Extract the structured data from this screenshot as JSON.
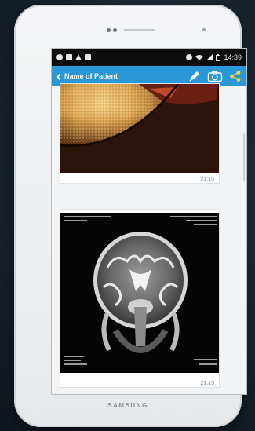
{
  "device": {
    "brand": "SAMSUNG"
  },
  "status_bar": {
    "time": "14:39",
    "left_icons": [
      "notification-icon",
      "message-icon",
      "warning-icon",
      "image-icon"
    ],
    "right_icons": [
      "alarm-icon",
      "wifi-icon",
      "signal-icon",
      "battery-icon"
    ]
  },
  "action_bar": {
    "title": "Name of Patient",
    "color": "#2a98d6",
    "actions": [
      "edit-pen-icon",
      "camera-icon",
      "share-icon"
    ]
  },
  "messages": [
    {
      "type": "photo",
      "content": "close-up medical photograph",
      "time": "21:15"
    },
    {
      "type": "photo",
      "content": "MRI brain scan",
      "time": "21:15"
    }
  ]
}
